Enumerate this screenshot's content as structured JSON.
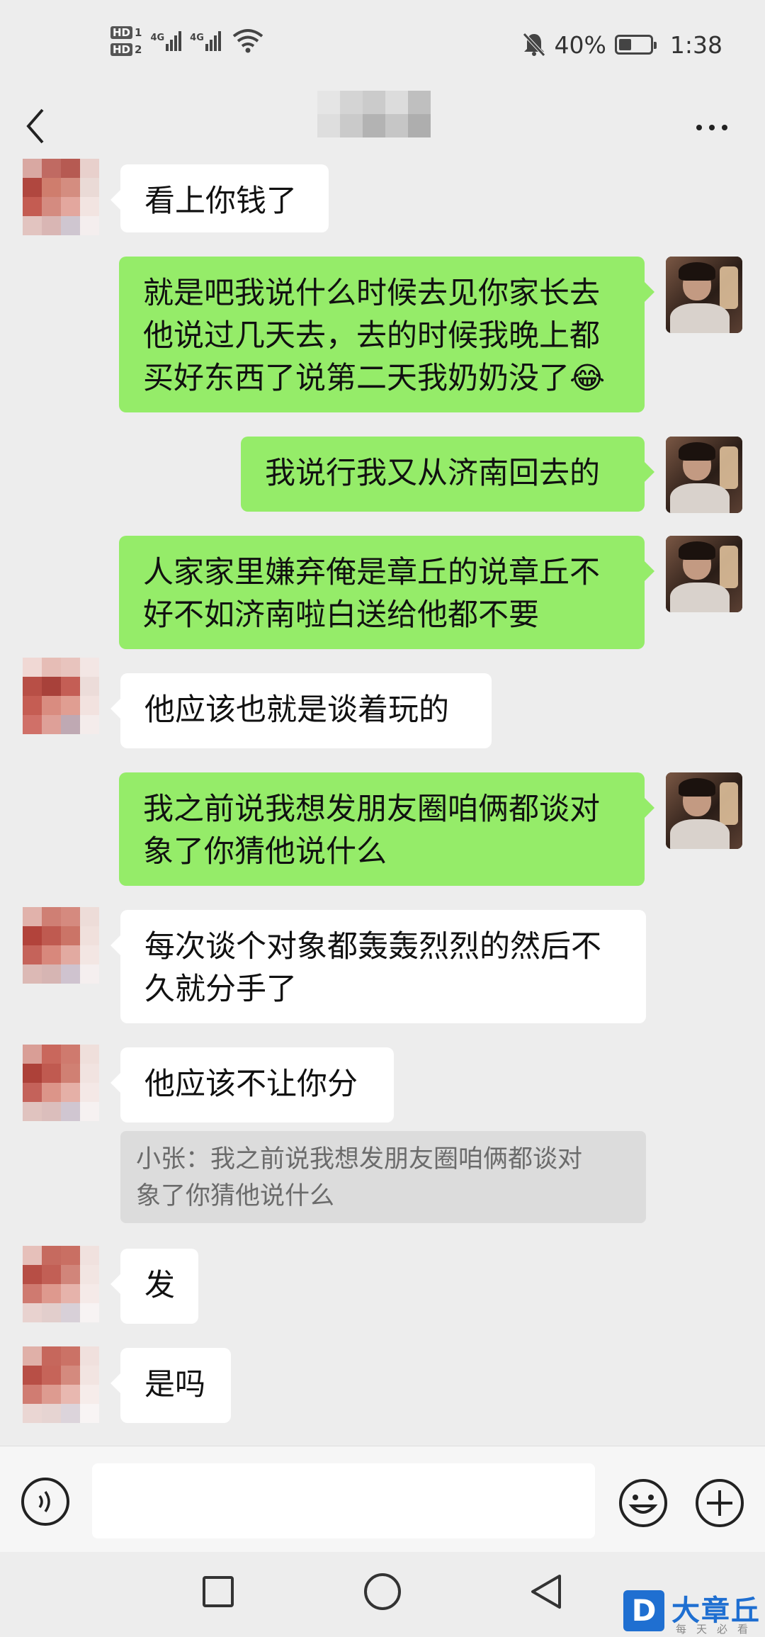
{
  "status_bar": {
    "hd1": "HD",
    "hd1_num": "1",
    "hd2": "HD",
    "hd2_num": "2",
    "net1": "4G",
    "net2": "4G",
    "battery_percent": "40%",
    "battery_level": 0.4,
    "time": "1:38"
  },
  "header": {
    "title_blurred": true,
    "back_icon": "chevron-left-icon",
    "more_icon": "ellipsis-icon"
  },
  "messages": [
    {
      "side": "in",
      "text": "看上你钱了"
    },
    {
      "side": "out",
      "text": "就是吧我说什么时候去见你家长去\n他说过几天去，去的时候我晚上都\n买好东西了说第二天我奶奶没了😂"
    },
    {
      "side": "out",
      "text": "我说行我又从济南回去的"
    },
    {
      "side": "out",
      "text": "人家家里嫌弃俺是章丘的说章丘不\n好不如济南啦白送给他都不要"
    },
    {
      "side": "in",
      "text": "他应该也就是谈着玩的"
    },
    {
      "side": "out",
      "text": "我之前说我想发朋友圈咱俩都谈对\n象了你猜他说什么"
    },
    {
      "side": "in",
      "text": "每次谈个对象都轰轰烈烈的然后不\n久就分手了"
    },
    {
      "side": "in",
      "text": "他应该不让你分"
    },
    {
      "side": "quote",
      "text": "小张：我之前说我想发朋友圈咱俩都谈对\n象了你猜他说什么"
    },
    {
      "side": "in",
      "text": "发"
    },
    {
      "side": "in",
      "text": "是吗"
    }
  ],
  "input_bar": {
    "voice_icon": "voice-icon",
    "emoji_icon": "emoji-icon",
    "plus_icon": "plus-icon",
    "text_value": ""
  },
  "nav_bar": {
    "recent_icon": "square-icon",
    "home_icon": "circle-icon",
    "back_icon": "triangle-back-icon"
  },
  "watermark": {
    "badge": "D",
    "name": "大章丘",
    "sub": "每天必看"
  },
  "colors": {
    "background": "#ededed",
    "outgoing_bubble": "#95ec69",
    "incoming_bubble": "#ffffff",
    "quote_bg": "#dcdcdc",
    "watermark_blue": "#1f6fd1"
  }
}
